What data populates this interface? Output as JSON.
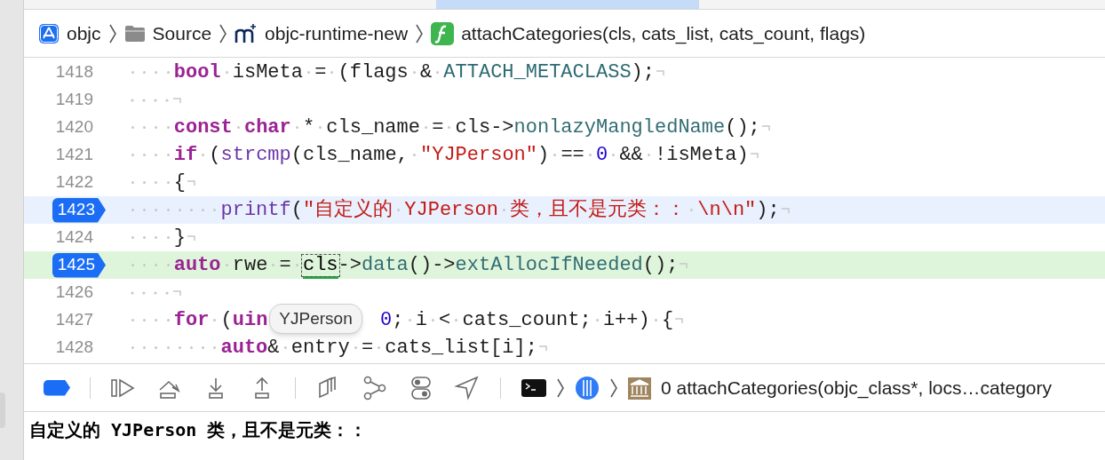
{
  "breadcrumbs": [
    {
      "kind": "app",
      "label": "objc"
    },
    {
      "kind": "folder",
      "label": "Source"
    },
    {
      "kind": "module",
      "label": "objc-runtime-new"
    },
    {
      "kind": "function",
      "label": "attachCategories(cls, cats_list, cats_count, flags)"
    }
  ],
  "lines": [
    {
      "number": "1418",
      "breakpoint": false,
      "selected": false,
      "executing": false,
      "tokens": [
        {
          "kind": "keyword",
          "text": "    bool"
        },
        {
          "kind": "plain",
          "text": " isMeta = (flags & "
        },
        {
          "kind": "macro",
          "text": "ATTACH_METACLASS"
        },
        {
          "kind": "plain",
          "text": ");"
        }
      ]
    },
    {
      "number": "1419",
      "breakpoint": false,
      "selected": false,
      "executing": false
    },
    {
      "number": "1420",
      "breakpoint": false,
      "selected": false,
      "executing": false,
      "tokens": [
        {
          "kind": "keyword",
          "text": "    const char"
        },
        {
          "kind": "plain",
          "text": " * cls_name = cls->"
        },
        {
          "kind": "method",
          "text": "nonlazyMangledName"
        },
        {
          "kind": "plain",
          "text": "();"
        }
      ]
    },
    {
      "number": "1421",
      "breakpoint": false,
      "selected": false,
      "executing": false,
      "tokens": [
        {
          "kind": "keyword",
          "text": "    if"
        },
        {
          "kind": "plain",
          "text": " ("
        },
        {
          "kind": "function",
          "text": "strcmp"
        },
        {
          "kind": "plain",
          "text": "(cls_name, "
        },
        {
          "kind": "string",
          "text": "\"YJPerson\""
        },
        {
          "kind": "plain",
          "text": ") == "
        },
        {
          "kind": "number",
          "text": "0"
        },
        {
          "kind": "plain",
          "text": " && !isMeta)"
        }
      ]
    },
    {
      "number": "1422",
      "breakpoint": false,
      "selected": false,
      "executing": false,
      "tokens": [
        {
          "kind": "plain",
          "text": "    {"
        }
      ]
    },
    {
      "number": "1423",
      "breakpoint": true,
      "selected": true,
      "executing": false,
      "tokens": [
        {
          "kind": "function",
          "text": "        printf"
        },
        {
          "kind": "plain",
          "text": "("
        },
        {
          "kind": "string",
          "text": "\"自定义的 YJPerson 类，且不是元类：： \\n\\n\""
        },
        {
          "kind": "plain",
          "text": ");"
        }
      ]
    },
    {
      "number": "1424",
      "breakpoint": false,
      "selected": false,
      "executing": false,
      "tokens": [
        {
          "kind": "plain",
          "text": "    }"
        }
      ]
    },
    {
      "number": "1425",
      "breakpoint": true,
      "selected": false,
      "executing": true,
      "tokens": [
        {
          "kind": "keyword",
          "text": "    auto"
        },
        {
          "kind": "plain",
          "text": " rwe = "
        },
        {
          "kind": "hovered",
          "text": "cls"
        },
        {
          "kind": "plain",
          "text": "->"
        },
        {
          "kind": "method",
          "text": "data"
        },
        {
          "kind": "plain",
          "text": "()->"
        },
        {
          "kind": "method",
          "text": "extAllocIfNeeded"
        },
        {
          "kind": "plain",
          "text": "();"
        }
      ]
    },
    {
      "number": "1426",
      "breakpoint": false,
      "selected": false,
      "executing": false
    },
    {
      "number": "1427",
      "breakpoint": false,
      "selected": false,
      "executing": false,
      "tokens": [
        {
          "kind": "keyword",
          "text": "    for"
        },
        {
          "kind": "plain",
          "text": " ("
        },
        {
          "kind": "keyword",
          "text": "uin"
        },
        {
          "kind": "tooltip",
          "text": "YJPerson"
        },
        {
          "kind": "number",
          "text": "0"
        },
        {
          "kind": "plain",
          "text": "; i < cats_count; i++) {"
        }
      ]
    },
    {
      "number": "1428",
      "breakpoint": false,
      "selected": false,
      "executing": false,
      "tokens": [
        {
          "kind": "keyword",
          "text": "        auto"
        },
        {
          "kind": "plain",
          "text": "& entry = cats_list[i];"
        }
      ]
    }
  ],
  "debug_bar": {
    "breakpoints_active": true,
    "frame": "0 attachCategories(objc_class*, locs…category"
  },
  "console": {
    "output": "自定义的 YJPerson 类，且不是元类：："
  }
}
